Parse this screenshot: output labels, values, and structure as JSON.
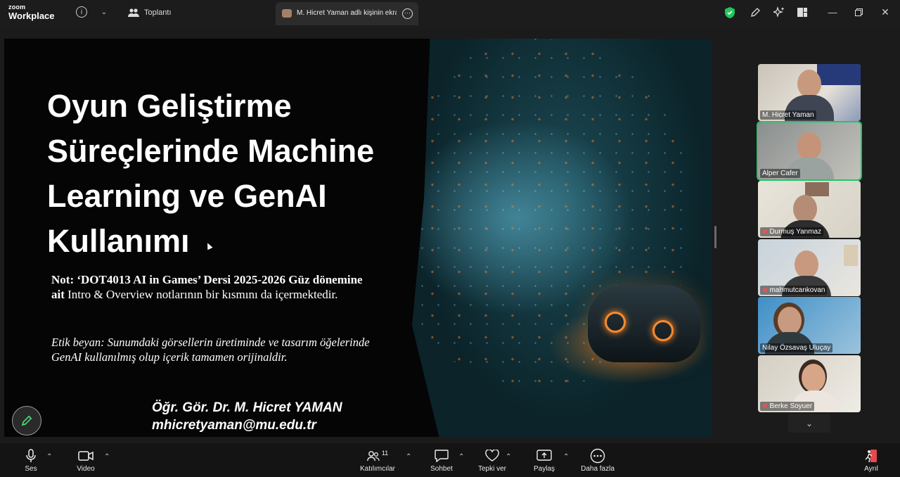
{
  "app": {
    "logo_top": "zoom",
    "logo_bottom": "Workplace",
    "meeting_label": "Toplantı",
    "share_tab_title": "M. Hicret Yaman adlı kişinin ekranı"
  },
  "slide": {
    "title_lines": [
      "Oyun Geliştirme",
      "Süreçlerinde Machine",
      "Learning ve GenAI",
      "Kullanımı"
    ],
    "note_bold": "Not: ‘DOT4013 AI in Games’ Dersi 2025-2026 Güz dönemine ait",
    "note_rest": " Intro & Overview notlarının bir kısmını da içermektedir.",
    "ethics": "Etik beyan: Sunumdaki görsellerin üretiminde ve tasarım öğelerinde GenAI kullanılmış olup içerik tamamen orijinaldir.",
    "author": "Öğr. Gör. Dr. M. Hicret YAMAN",
    "email": "mhicretyaman@mu.edu.tr"
  },
  "participants": [
    {
      "name": "M. Hicret Yaman",
      "muted": false,
      "active": false
    },
    {
      "name": "Alper Cafer",
      "muted": false,
      "active": true
    },
    {
      "name": "Durmuş Yanmaz",
      "muted": true,
      "active": false
    },
    {
      "name": "mahmutcankovan",
      "muted": true,
      "active": false
    },
    {
      "name": "Nilay Özsavaş Uluçay",
      "muted": false,
      "active": false
    },
    {
      "name": "Berke Soyuer",
      "muted": true,
      "active": false
    }
  ],
  "toolbar": {
    "audio": "Ses",
    "video": "Video",
    "participants": "Katılımcılar",
    "participants_count": "11",
    "chat": "Sohbet",
    "react": "Tepki ver",
    "share": "Paylaş",
    "more": "Daha fazla",
    "leave": "Ayrıl"
  },
  "colors": {
    "active_speaker": "#22c56a",
    "security_shield": "#22c55e",
    "leave": "#e5484d"
  }
}
